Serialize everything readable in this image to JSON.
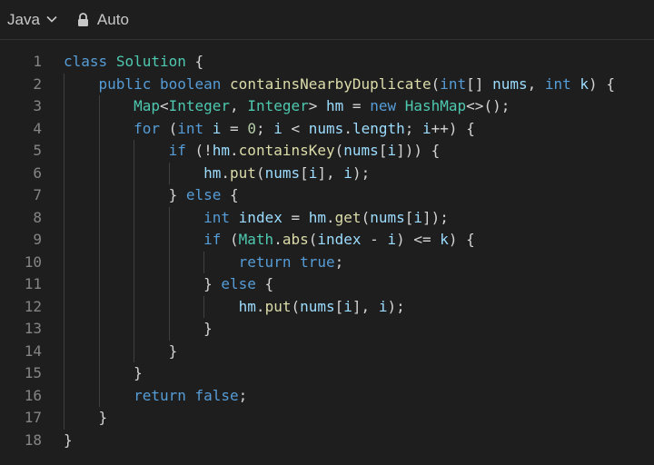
{
  "toolbar": {
    "language": "Java",
    "language_icon": "chevron-down-icon",
    "mode": "Auto",
    "mode_icon": "lock-icon"
  },
  "colors": {
    "background": "#1e1e1e",
    "keyword": "#569cd6",
    "type": "#4ec9b0",
    "method": "#dcdcaa",
    "variable": "#9cdcfe",
    "number": "#b5cea8",
    "plain": "#d4d4d4",
    "line_number": "#858585"
  },
  "code_lines": [
    {
      "n": "1",
      "tokens": [
        [
          "class",
          "k"
        ],
        [
          " ",
          "p"
        ],
        [
          "Solution",
          "t"
        ],
        [
          " {",
          "p"
        ]
      ]
    },
    {
      "n": "2",
      "tokens": [
        [
          "    ",
          "p"
        ],
        [
          "public",
          "k"
        ],
        [
          " ",
          "p"
        ],
        [
          "boolean",
          "k"
        ],
        [
          " ",
          "p"
        ],
        [
          "containsNearbyDuplicate",
          "m"
        ],
        [
          "(",
          "p"
        ],
        [
          "int",
          "k"
        ],
        [
          "[] ",
          "p"
        ],
        [
          "nums",
          "v"
        ],
        [
          ", ",
          "p"
        ],
        [
          "int",
          "k"
        ],
        [
          " ",
          "p"
        ],
        [
          "k",
          "v"
        ],
        [
          ") {",
          "p"
        ]
      ]
    },
    {
      "n": "3",
      "tokens": [
        [
          "        ",
          "p"
        ],
        [
          "Map",
          "t"
        ],
        [
          "<",
          "p"
        ],
        [
          "Integer",
          "t"
        ],
        [
          ", ",
          "p"
        ],
        [
          "Integer",
          "t"
        ],
        [
          "> ",
          "p"
        ],
        [
          "hm",
          "v"
        ],
        [
          " = ",
          "p"
        ],
        [
          "new",
          "k"
        ],
        [
          " ",
          "p"
        ],
        [
          "HashMap",
          "t"
        ],
        [
          "<>();",
          "p"
        ]
      ]
    },
    {
      "n": "4",
      "tokens": [
        [
          "        ",
          "p"
        ],
        [
          "for",
          "k"
        ],
        [
          " (",
          "p"
        ],
        [
          "int",
          "k"
        ],
        [
          " ",
          "p"
        ],
        [
          "i",
          "v"
        ],
        [
          " = ",
          "p"
        ],
        [
          "0",
          "n"
        ],
        [
          "; ",
          "p"
        ],
        [
          "i",
          "v"
        ],
        [
          " < ",
          "p"
        ],
        [
          "nums",
          "v"
        ],
        [
          ".",
          "p"
        ],
        [
          "length",
          "v"
        ],
        [
          "; ",
          "p"
        ],
        [
          "i",
          "v"
        ],
        [
          "++) {",
          "p"
        ]
      ]
    },
    {
      "n": "5",
      "tokens": [
        [
          "            ",
          "p"
        ],
        [
          "if",
          "k"
        ],
        [
          " (!",
          "p"
        ],
        [
          "hm",
          "v"
        ],
        [
          ".",
          "p"
        ],
        [
          "containsKey",
          "m"
        ],
        [
          "(",
          "p"
        ],
        [
          "nums",
          "v"
        ],
        [
          "[",
          "p"
        ],
        [
          "i",
          "v"
        ],
        [
          "])) {",
          "p"
        ]
      ]
    },
    {
      "n": "6",
      "tokens": [
        [
          "                ",
          "p"
        ],
        [
          "hm",
          "v"
        ],
        [
          ".",
          "p"
        ],
        [
          "put",
          "m"
        ],
        [
          "(",
          "p"
        ],
        [
          "nums",
          "v"
        ],
        [
          "[",
          "p"
        ],
        [
          "i",
          "v"
        ],
        [
          "], ",
          "p"
        ],
        [
          "i",
          "v"
        ],
        [
          ");",
          "p"
        ]
      ]
    },
    {
      "n": "7",
      "tokens": [
        [
          "            ",
          "p"
        ],
        [
          "} ",
          "p"
        ],
        [
          "else",
          "k"
        ],
        [
          " {",
          "p"
        ]
      ]
    },
    {
      "n": "8",
      "tokens": [
        [
          "                ",
          "p"
        ],
        [
          "int",
          "k"
        ],
        [
          " ",
          "p"
        ],
        [
          "index",
          "v"
        ],
        [
          " = ",
          "p"
        ],
        [
          "hm",
          "v"
        ],
        [
          ".",
          "p"
        ],
        [
          "get",
          "m"
        ],
        [
          "(",
          "p"
        ],
        [
          "nums",
          "v"
        ],
        [
          "[",
          "p"
        ],
        [
          "i",
          "v"
        ],
        [
          "]);",
          "p"
        ]
      ]
    },
    {
      "n": "9",
      "tokens": [
        [
          "                ",
          "p"
        ],
        [
          "if",
          "k"
        ],
        [
          " (",
          "p"
        ],
        [
          "Math",
          "t"
        ],
        [
          ".",
          "p"
        ],
        [
          "abs",
          "m"
        ],
        [
          "(",
          "p"
        ],
        [
          "index",
          "v"
        ],
        [
          " - ",
          "p"
        ],
        [
          "i",
          "v"
        ],
        [
          ") <= ",
          "p"
        ],
        [
          "k",
          "v"
        ],
        [
          ") {",
          "p"
        ]
      ]
    },
    {
      "n": "10",
      "tokens": [
        [
          "                    ",
          "p"
        ],
        [
          "return",
          "k"
        ],
        [
          " ",
          "p"
        ],
        [
          "true",
          "k"
        ],
        [
          ";",
          "p"
        ]
      ]
    },
    {
      "n": "11",
      "tokens": [
        [
          "                ",
          "p"
        ],
        [
          "} ",
          "p"
        ],
        [
          "else",
          "k"
        ],
        [
          " {",
          "p"
        ]
      ]
    },
    {
      "n": "12",
      "tokens": [
        [
          "                    ",
          "p"
        ],
        [
          "hm",
          "v"
        ],
        [
          ".",
          "p"
        ],
        [
          "put",
          "m"
        ],
        [
          "(",
          "p"
        ],
        [
          "nums",
          "v"
        ],
        [
          "[",
          "p"
        ],
        [
          "i",
          "v"
        ],
        [
          "], ",
          "p"
        ],
        [
          "i",
          "v"
        ],
        [
          ");",
          "p"
        ]
      ]
    },
    {
      "n": "13",
      "tokens": [
        [
          "                ",
          "p"
        ],
        [
          "}",
          "p"
        ]
      ]
    },
    {
      "n": "14",
      "tokens": [
        [
          "            ",
          "p"
        ],
        [
          "}",
          "p"
        ]
      ]
    },
    {
      "n": "15",
      "tokens": [
        [
          "        ",
          "p"
        ],
        [
          "}",
          "p"
        ]
      ]
    },
    {
      "n": "16",
      "tokens": [
        [
          "        ",
          "p"
        ],
        [
          "return",
          "k"
        ],
        [
          " ",
          "p"
        ],
        [
          "false",
          "k"
        ],
        [
          ";",
          "p"
        ]
      ]
    },
    {
      "n": "17",
      "tokens": [
        [
          "    ",
          "p"
        ],
        [
          "}",
          "p"
        ]
      ]
    },
    {
      "n": "18",
      "tokens": [
        [
          "}",
          "p"
        ]
      ]
    }
  ]
}
